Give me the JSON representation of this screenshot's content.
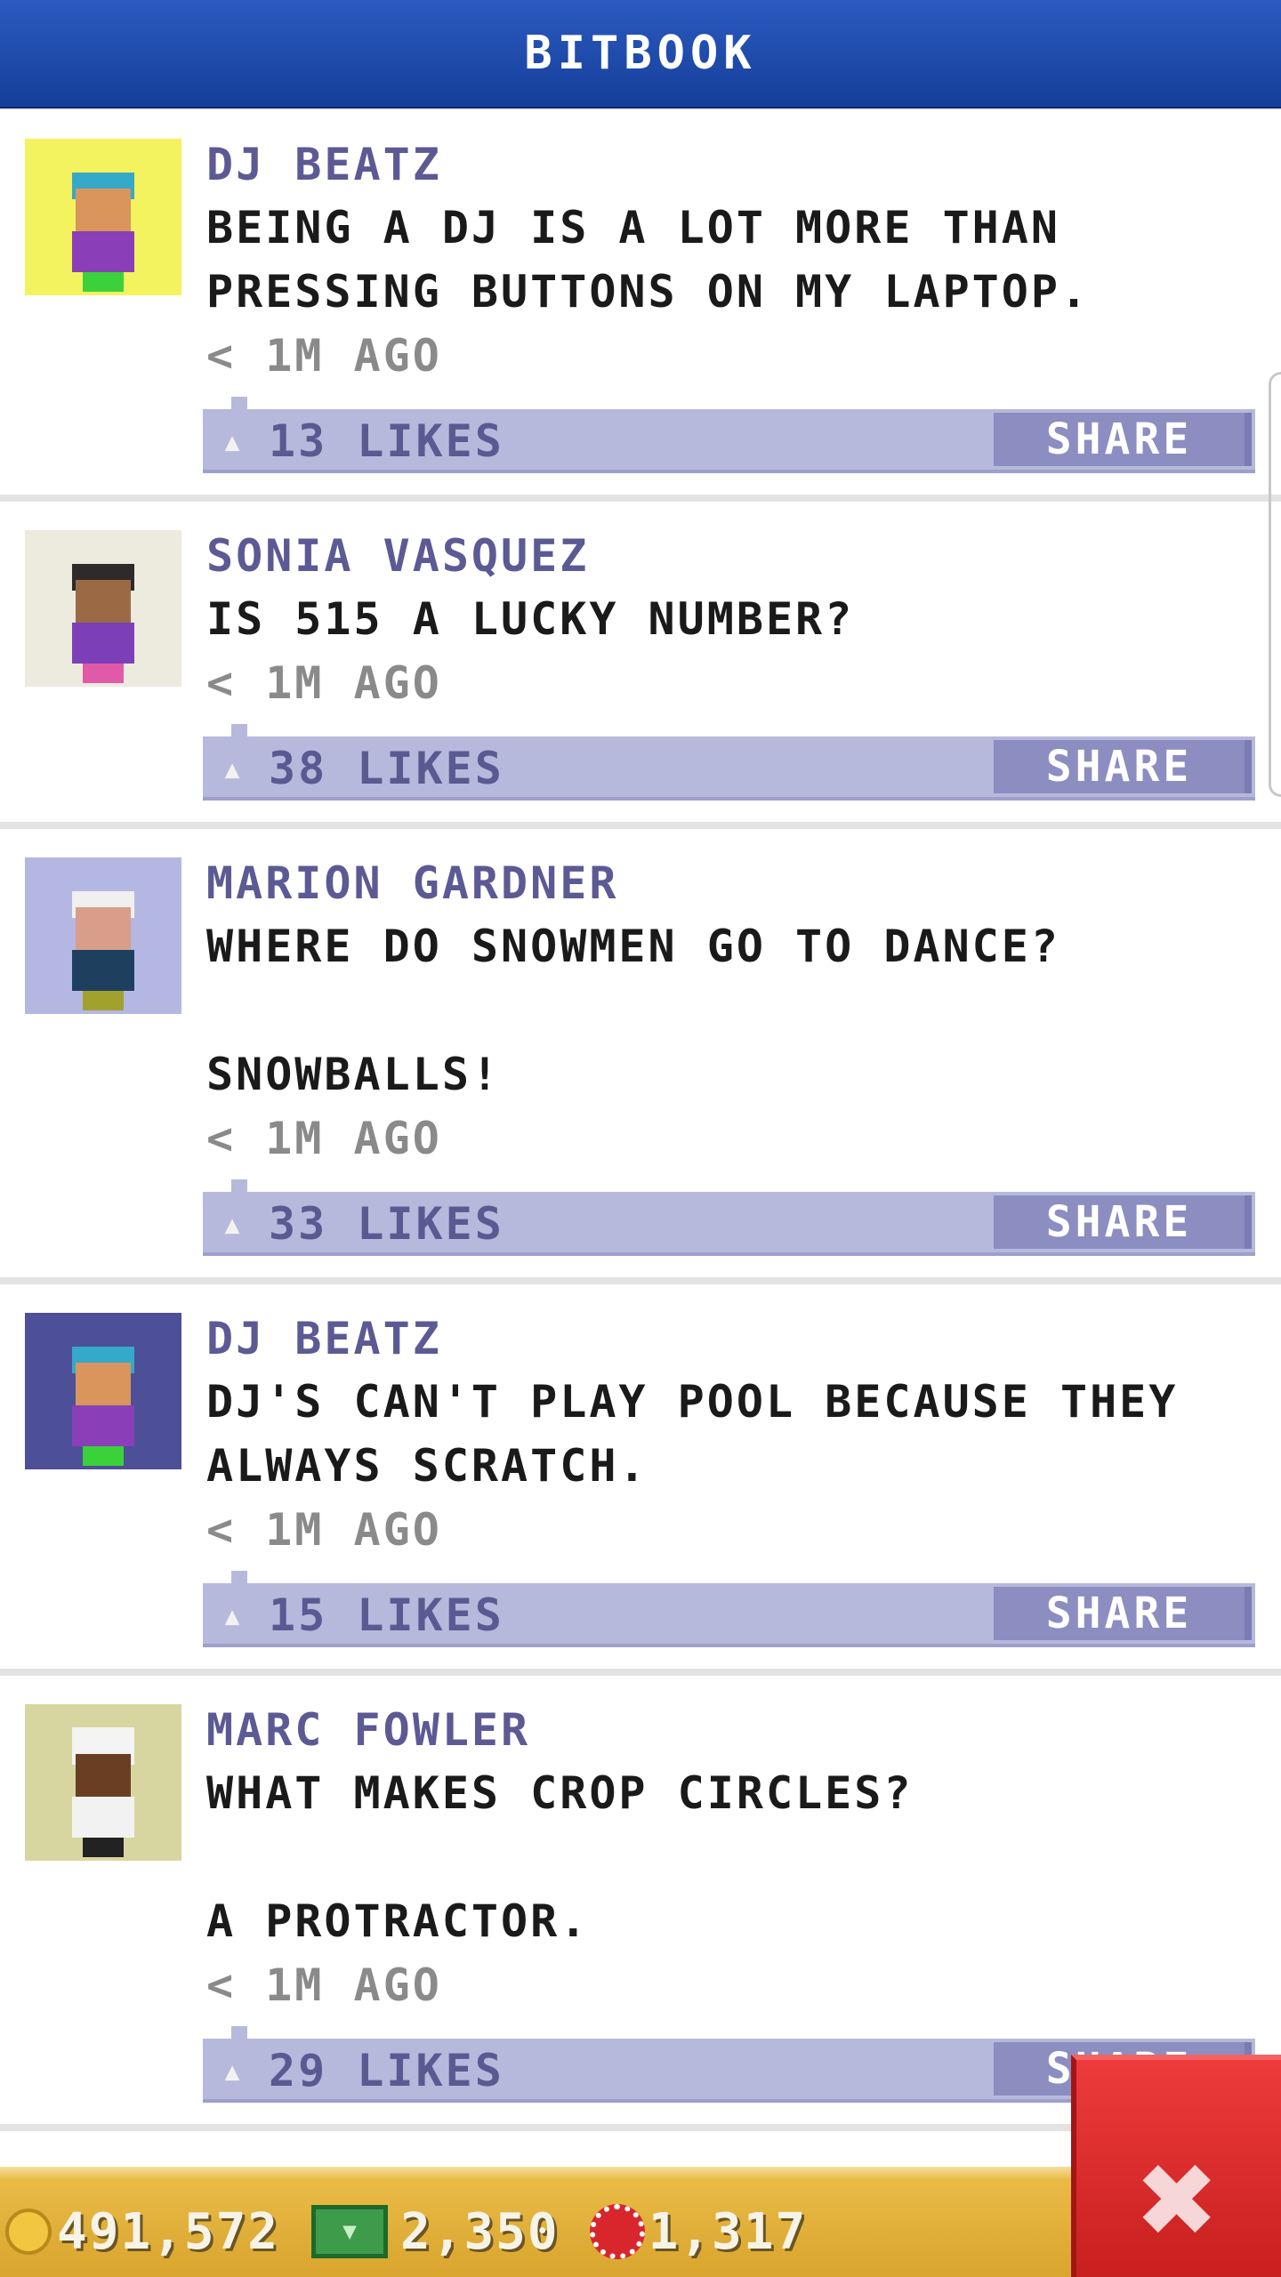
{
  "header": {
    "title": "BITBOOK"
  },
  "posts": [
    {
      "author": "DJ BEATZ",
      "message": "BEING A DJ IS A LOT MORE THAN\nPRESSING BUTTONS ON MY LAPTOP.",
      "time": "< 1M AGO",
      "likes": "13 LIKES",
      "share": "SHARE",
      "avatar_bg": "#f3f25f",
      "avatar": "dj-avatar-icon"
    },
    {
      "author": "SONIA VASQUEZ",
      "message": "IS 515 A LUCKY NUMBER?",
      "time": "< 1M AGO",
      "likes": "38 LIKES",
      "share": "SHARE",
      "avatar_bg": "#ecebde",
      "avatar": "woman-avatar-icon"
    },
    {
      "author": "MARION GARDNER",
      "message": "WHERE DO SNOWMEN GO TO DANCE?\n\nSNOWBALLS!",
      "time": "< 1M AGO",
      "likes": "33 LIKES",
      "share": "SHARE",
      "avatar_bg": "#b5b7e3",
      "avatar": "elder-avatar-icon"
    },
    {
      "author": "DJ BEATZ",
      "message": "DJ'S CAN'T PLAY POOL BECAUSE THEY\nALWAYS SCRATCH.",
      "time": "< 1M AGO",
      "likes": "15 LIKES",
      "share": "SHARE",
      "avatar_bg": "#4d4f98",
      "avatar": "dj-avatar-icon"
    },
    {
      "author": "MARC FOWLER",
      "message": "WHAT MAKES CROP CIRCLES?\n\nA PROTRACTOR.",
      "time": "< 1M AGO",
      "likes": "29 LIKES",
      "share": "SHARE",
      "avatar_bg": "#d8d6a0",
      "avatar": "chef-avatar-icon"
    }
  ],
  "currency": {
    "coins": "491,572",
    "bux": "2,350",
    "chips": "1,317",
    "coin_icon": "coin-icon",
    "bux_icon": "cash-icon",
    "chip_icon": "chip-icon"
  },
  "close_button": {
    "icon": "close-icon",
    "symbol": "✖"
  }
}
